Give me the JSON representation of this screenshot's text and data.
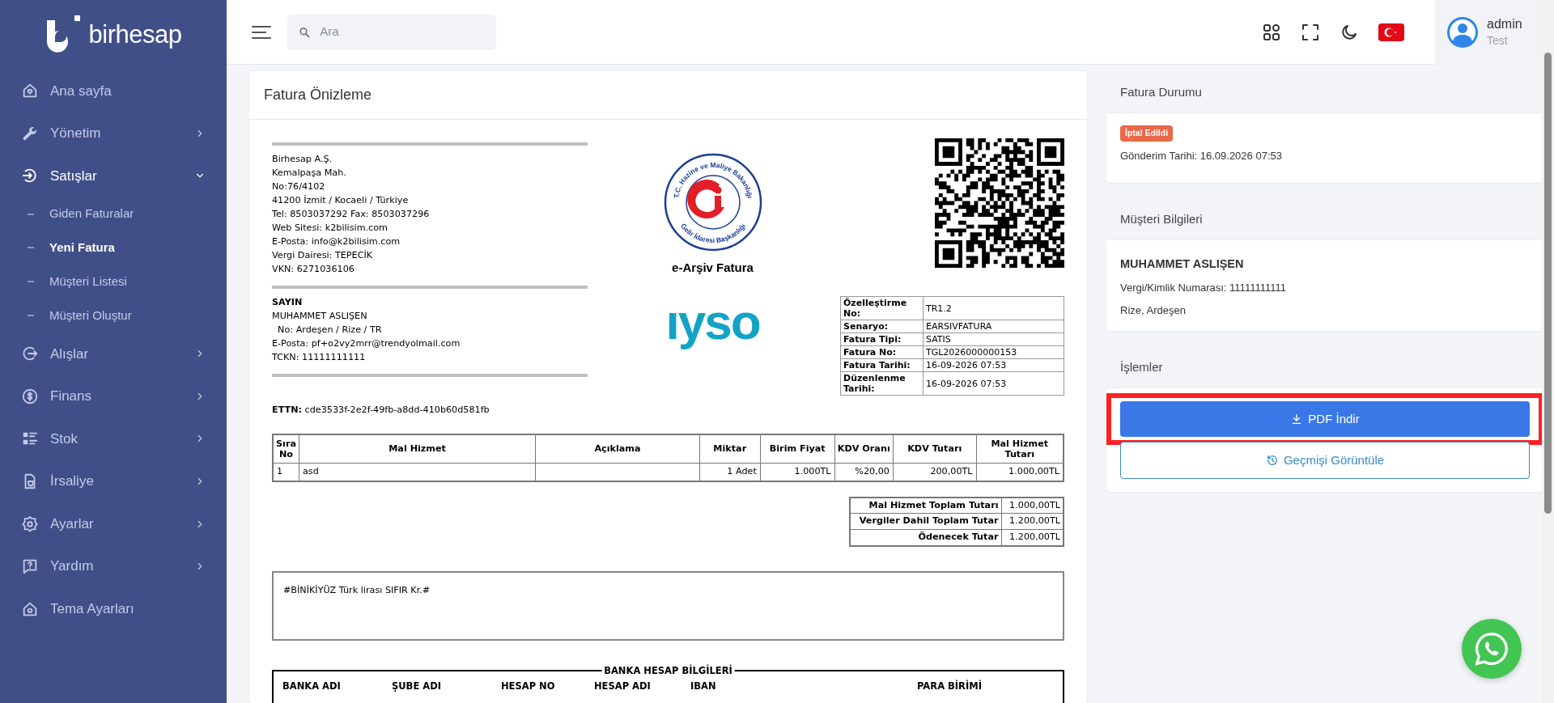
{
  "brand": {
    "name": "birhesap"
  },
  "sidebar": {
    "items": [
      {
        "label": "Ana sayfa",
        "kind": "link",
        "selected": false
      },
      {
        "label": "Yönetim",
        "kind": "group",
        "expanded": false,
        "selected": false
      },
      {
        "label": "Satışlar",
        "kind": "group",
        "expanded": true,
        "selected": true,
        "children": [
          {
            "label": "Giden Faturalar",
            "selected": false
          },
          {
            "label": "Yeni Fatura",
            "selected": true
          },
          {
            "label": "Müşteri Listesi",
            "selected": false
          },
          {
            "label": "Müşteri Oluştur",
            "selected": false
          }
        ]
      },
      {
        "label": "Alışlar",
        "kind": "group",
        "expanded": false,
        "selected": false
      },
      {
        "label": "Finans",
        "kind": "group",
        "expanded": false,
        "selected": false
      },
      {
        "label": "Stok",
        "kind": "group",
        "expanded": false,
        "selected": false
      },
      {
        "label": "İrsaliye",
        "kind": "group",
        "expanded": false,
        "selected": false
      },
      {
        "label": "Ayarlar",
        "kind": "group",
        "expanded": false,
        "selected": false
      },
      {
        "label": "Yardım",
        "kind": "group",
        "expanded": false,
        "selected": false
      },
      {
        "label": "Tema Ayarları",
        "kind": "link",
        "selected": false
      }
    ]
  },
  "topbar": {
    "search": {
      "placeholder": "Ara"
    },
    "user": {
      "name": "admin",
      "role": "Test"
    }
  },
  "invoice_preview": {
    "title": "Fatura Önizleme",
    "seller_lines": [
      "Birhesap A.Ş.",
      "Kemalpaşa Mah.",
      "No:76/4102",
      "41200 İzmit / Kocaeli / Türkiye",
      "Tel: 8503037292 Fax: 8503037296",
      "Web Sitesi: k2bilisim.com",
      "E-Posta: info@k2bilisim.com",
      "Vergi Dairesi: TEPECİK",
      "VKN: 6271036106"
    ],
    "seal": {
      "top_text": "T.C. Hazine ve Maliye Bakanlığı",
      "bottom_text": "Gelir İdaresi Başkanlığı"
    },
    "document_type": "e-Arşiv Fatura",
    "logo_text": "ıyso",
    "buyer": {
      "heading": "SAYIN",
      "lines": [
        "MUHAMMET ASLIŞEN",
        "  No: Ardeşen / Rize / TR",
        "E-Posta: pf+o2vy2mrr@trendyolmail.com",
        "TCKN: 11111111111"
      ]
    },
    "info": [
      {
        "label": "Özelleştirme No:",
        "value": "TR1.2"
      },
      {
        "label": "Senaryo:",
        "value": "EARSIVFATURA"
      },
      {
        "label": "Fatura Tipi:",
        "value": "SATIS"
      },
      {
        "label": "Fatura No:",
        "value": "TGL2026000000153"
      },
      {
        "label": "Fatura Tarihi:",
        "value": "16-09-2026 07:53"
      },
      {
        "label": "Düzenlenme Tarihi:",
        "value": "16-09-2026 07:53"
      }
    ],
    "ettn": {
      "label": "ETTN:",
      "value": "cde3533f-2e2f-49fb-a8dd-410b60d581fb"
    },
    "items": {
      "columns": [
        "Sıra No",
        "Mal Hizmet",
        "Açıklama",
        "Miktar",
        "Birim Fiyat",
        "KDV Oranı",
        "KDV Tutarı",
        "Mal Hizmet Tutarı"
      ],
      "rows": [
        [
          "1",
          "asd",
          "",
          "1 Adet",
          "1.000TL",
          "%20,00",
          "200,00TL",
          "1.000,00TL"
        ]
      ]
    },
    "totals": [
      {
        "label": "Mal Hizmet Toplam Tutarı",
        "value": "1.000,00TL"
      },
      {
        "label": "Vergiler Dahil Toplam Tutar",
        "value": "1.200,00TL"
      },
      {
        "label": "Ödenecek Tutar",
        "value": "1.200,00TL"
      }
    ],
    "note": "#BİNİKİYÜZ Türk lirası SIFIR Kr.#",
    "bank": {
      "title": "BANKA HESAP BİLGİLERİ",
      "columns": [
        "BANKA ADI",
        "ŞUBE ADI",
        "HESAP NO",
        "HESAP ADI",
        "IBAN",
        "PARA BİRİMİ"
      ]
    }
  },
  "invoice_status": {
    "title": "Fatura Durumu",
    "badge": "İptal Edildi",
    "sent": "Gönderim Tarihi: 16.09.2026 07:53"
  },
  "customer": {
    "title": "Müşteri Bilgileri",
    "name": "MUHAMMET ASLIŞEN",
    "tax_id": "Vergi/Kimlik Numarası: 11111111111",
    "location": "Rize, Ardeşen"
  },
  "actions": {
    "title": "İşlemler",
    "buttons": [
      {
        "kind": "primary",
        "label": "PDF İndir",
        "highlighted": true
      },
      {
        "kind": "outline",
        "label": "Geçmişi Görüntüle",
        "highlighted": false
      }
    ]
  }
}
